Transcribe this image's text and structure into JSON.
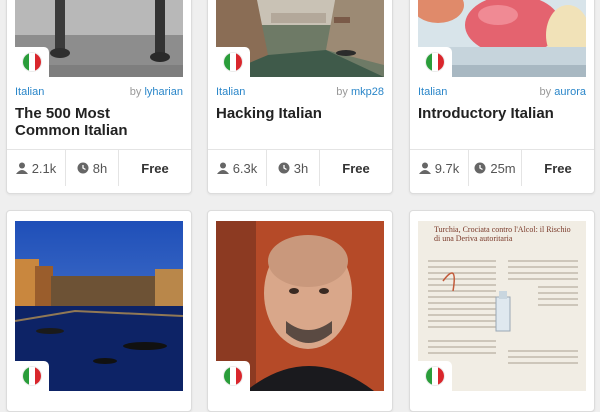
{
  "flag_colors": [
    "#2a9d3a",
    "#ffffff",
    "#d9262c"
  ],
  "cards": [
    {
      "language": "Italian",
      "by_prefix": "by",
      "author": "lyharian",
      "title_line1": "The 500 Most",
      "title_line2": "Common Italian",
      "learners": "2.1k",
      "duration": "8h",
      "price": "Free",
      "image": "stone-bollards-photo"
    },
    {
      "language": "Italian",
      "by_prefix": "by",
      "author": "mkp28",
      "title_line1": "Hacking Italian",
      "title_line2": "",
      "learners": "6.3k",
      "duration": "3h",
      "price": "Free",
      "image": "venice-canal-photo"
    },
    {
      "language": "Italian",
      "by_prefix": "by",
      "author": "aurora",
      "title_line1": "Introductory Italian",
      "title_line2": "",
      "learners": "9.7k",
      "duration": "25m",
      "price": "Free",
      "image": "gelato-photo"
    },
    {
      "image": "venice-night-photo"
    },
    {
      "image": "portrait-photo"
    },
    {
      "image": "newspaper-clipping-photo"
    }
  ],
  "clipping_text": "Turchia, Crociata contro l'Alcol: il Rischio di una Deriva autoritaria"
}
